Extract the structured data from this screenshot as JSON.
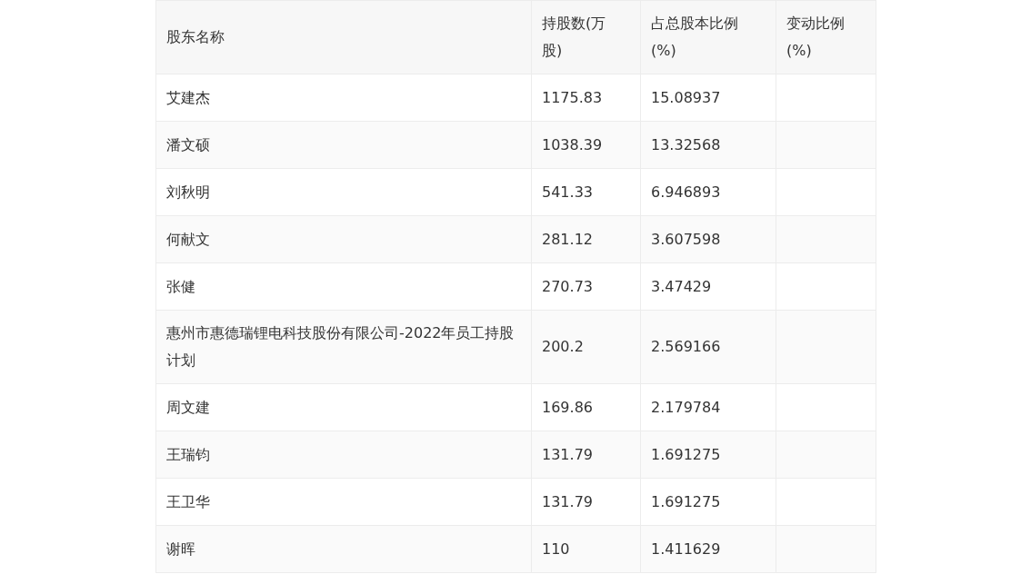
{
  "table": {
    "columns": [
      "股东名称",
      "持股数(万股)",
      "占总股本比例(%)",
      "变动比例(%)"
    ],
    "rows": [
      {
        "name": "艾建杰",
        "shares": "1175.83",
        "ratio": "15.08937"
      },
      {
        "name": "潘文硕",
        "shares": "1038.39",
        "ratio": "13.32568"
      },
      {
        "name": "刘秋明",
        "shares": "541.33",
        "ratio": "6.946893"
      },
      {
        "name": "何献文",
        "shares": "281.12",
        "ratio": "3.607598"
      },
      {
        "name": "张健",
        "shares": "270.73",
        "ratio": "3.47429"
      },
      {
        "name": "惠州市惠德瑞锂电科技股份有限公司-2022年员工持股计划",
        "shares": "200.2",
        "ratio": "2.569166"
      },
      {
        "name": "周文建",
        "shares": "169.86",
        "ratio": "2.179784"
      },
      {
        "name": "王瑞钧",
        "shares": "131.79",
        "ratio": "1.691275"
      },
      {
        "name": "王卫华",
        "shares": "131.79",
        "ratio": "1.691275"
      },
      {
        "name": "谢晖",
        "shares": "110",
        "ratio": "1.411629"
      }
    ]
  }
}
